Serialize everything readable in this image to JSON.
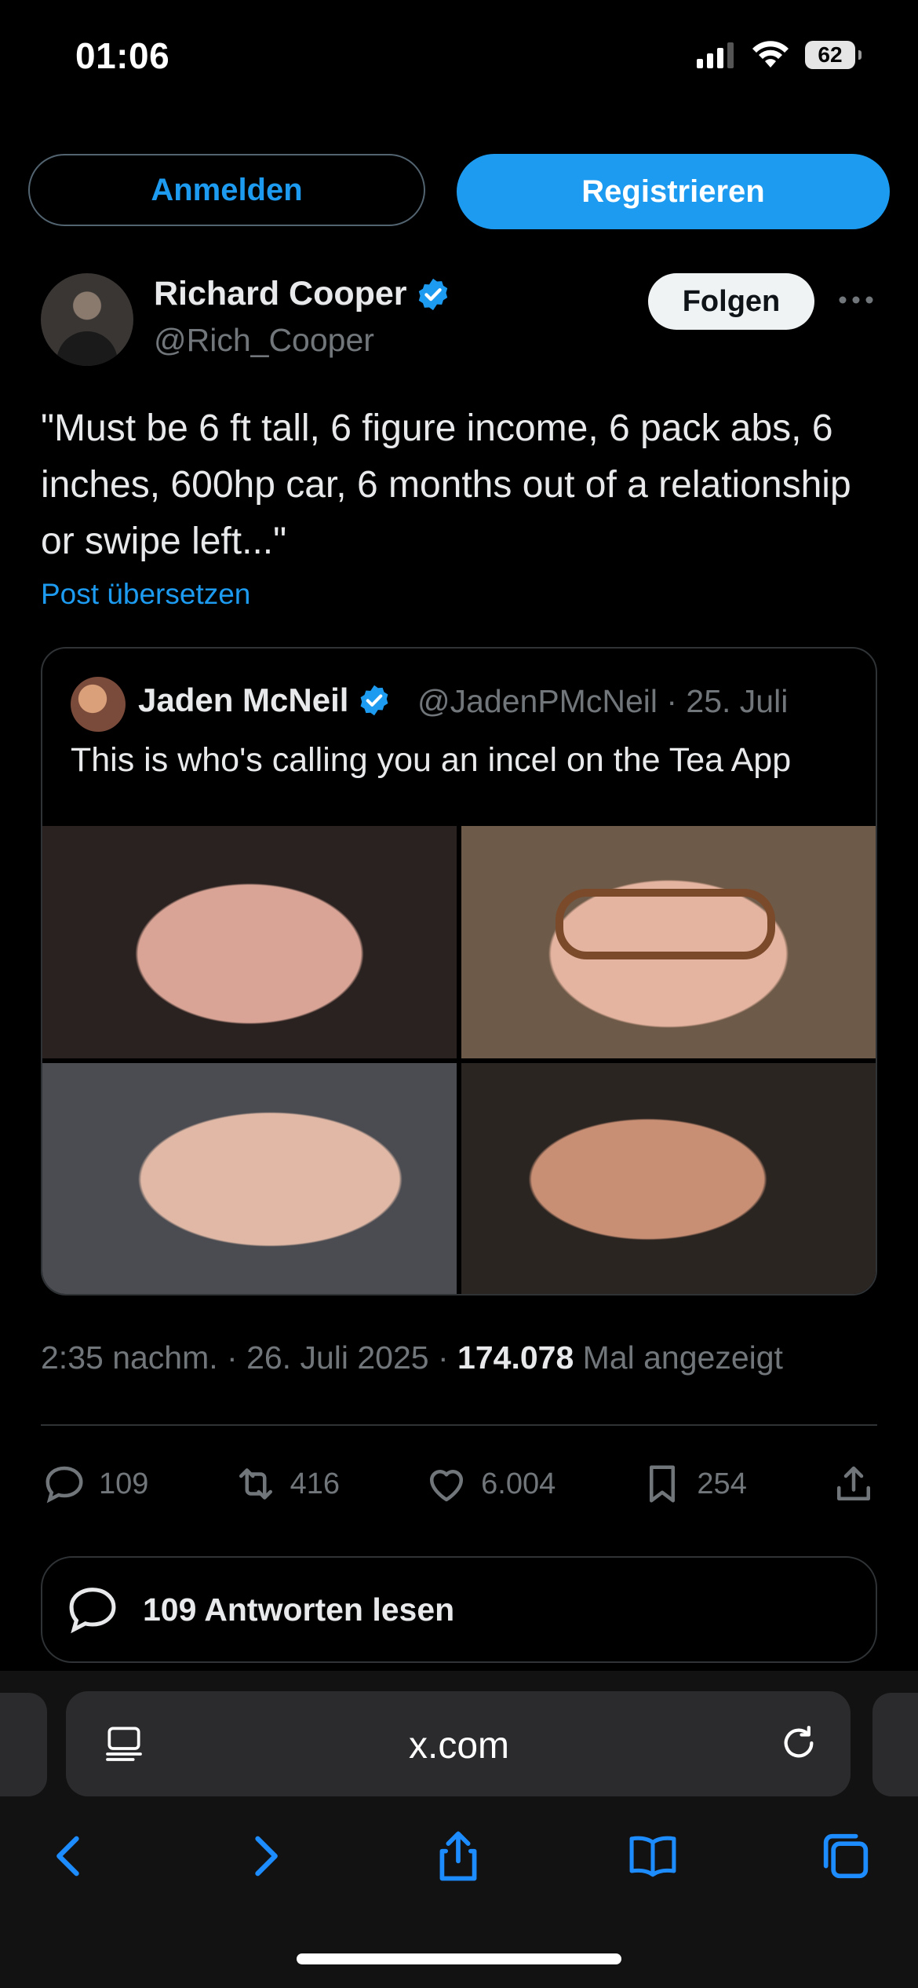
{
  "status": {
    "time": "01:06",
    "battery": "62"
  },
  "auth": {
    "login_label": "Anmelden",
    "register_label": "Registrieren"
  },
  "tweet": {
    "author_name": "Richard Cooper",
    "author_handle": "@Rich_Cooper",
    "follow_label": "Folgen",
    "text": "\"Must be 6 ft tall, 6 figure income, 6 pack abs, 6 inches, 600hp car, 6 months out of a relationship or swipe left...\"",
    "translate_label": "Post übersetzen",
    "timestamp": "2:35 nachm. · 26. Juli 2025 ·",
    "views_count": "174.078",
    "views_label": "Mal angezeigt",
    "replies": "109",
    "retweets": "416",
    "likes": "6.004",
    "bookmarks": "254",
    "read_replies_label": "109 Antworten lesen"
  },
  "quoted": {
    "author_name": "Jaden McNeil",
    "handle_date": "@JadenPMcNeil · 25. Juli",
    "text": "This is who's calling you an incel on the Tea App"
  },
  "browser": {
    "url": "x.com"
  },
  "colors": {
    "accent": "#1d9bf0",
    "muted": "#71767b",
    "border": "#2f3336"
  }
}
